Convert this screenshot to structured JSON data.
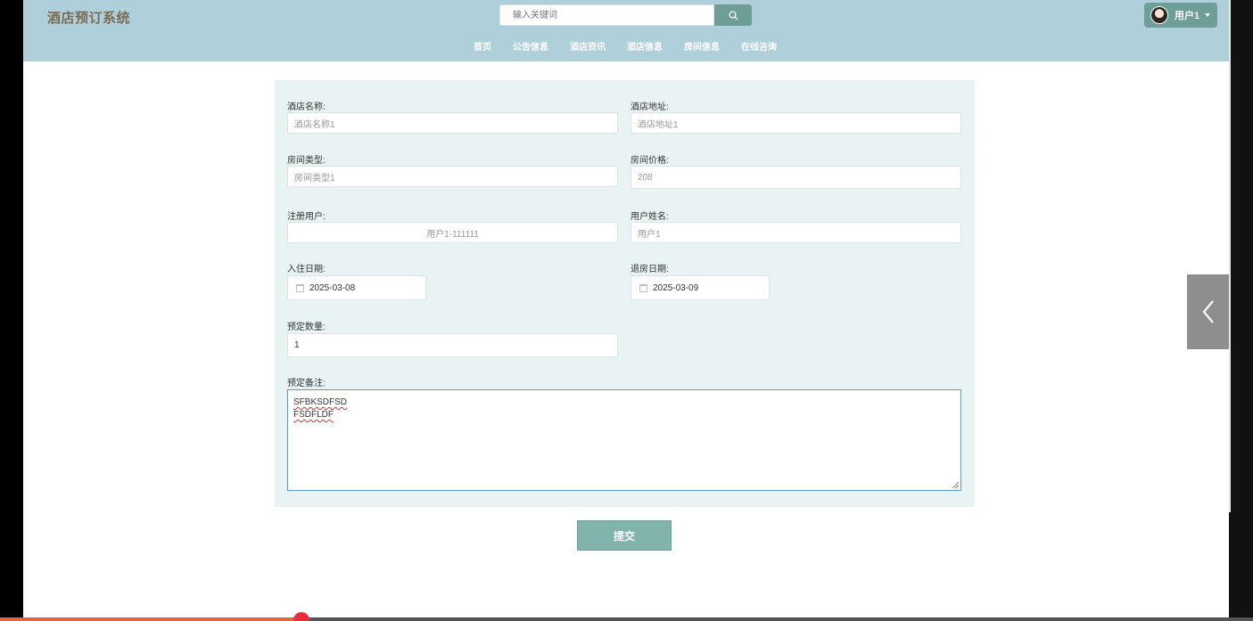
{
  "header": {
    "site_title": "酒店预订系统",
    "search_placeholder": "输入关键词",
    "user_name": "用户1"
  },
  "nav": {
    "items": [
      "首页",
      "公告信息",
      "酒店资讯",
      "酒店信息",
      "房间信息",
      "在线咨询"
    ]
  },
  "form": {
    "hotel_name": {
      "label": "酒店名称:",
      "value": "酒店名称1"
    },
    "hotel_address": {
      "label": "酒店地址:",
      "value": "酒店地址1"
    },
    "room_type": {
      "label": "房间类型:",
      "value": "房间类型1"
    },
    "room_price": {
      "label": "房间价格:",
      "value": "208"
    },
    "registered_user": {
      "label": "注册用户:",
      "value": "用户1-111111"
    },
    "user_fullname": {
      "label": "用户姓名:",
      "value": "用户1"
    },
    "checkin_date": {
      "label": "入住日期:",
      "value": "2025-03-08"
    },
    "checkout_date": {
      "label": "退房日期:",
      "value": "2025-03-09"
    },
    "quantity": {
      "label": "预定数量:",
      "value": "1"
    },
    "remarks": {
      "label": "预定备注:",
      "line1": "SFBKSDFSD",
      "line2": "FSDFLDF"
    },
    "submit_label": "提交"
  },
  "colors": {
    "header_bg": "#afcfda",
    "accent": "#6f9e98",
    "panel_bg": "#e9f3f3",
    "submit_bg": "#82b4ae"
  },
  "icons": {
    "search": "search-icon",
    "calendar": "calendar-icon",
    "side_toggle": "chevron-left-icon",
    "caret": "caret-down-icon"
  }
}
